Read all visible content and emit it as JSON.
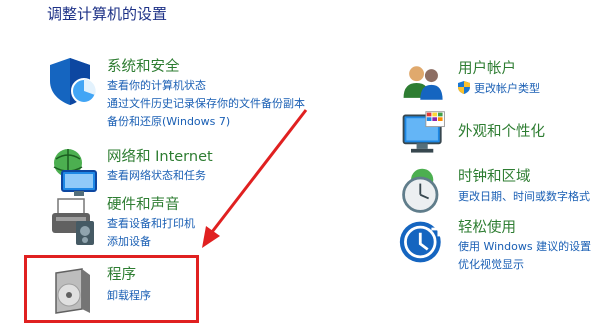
{
  "window": {
    "heading": "调整计算机的设置"
  },
  "left_categories": [
    {
      "title": "系统和安全",
      "icon": "shield-icon",
      "links": [
        "查看你的计算机状态",
        "通过文件历史记录保存你的文件备份副本",
        "备份和还原(Windows 7)"
      ]
    },
    {
      "title": "网络和 Internet",
      "icon": "network-icon",
      "links": [
        "查看网络状态和任务"
      ]
    },
    {
      "title": "硬件和声音",
      "icon": "printer-icon",
      "links": [
        "查看设备和打印机",
        "添加设备"
      ]
    },
    {
      "title": "程序",
      "icon": "programs-icon",
      "links": [
        "卸载程序"
      ]
    }
  ],
  "right_categories": [
    {
      "title": "用户帐户",
      "icon": "users-icon",
      "links": [
        "更改帐户类型"
      ]
    },
    {
      "title": "外观和个性化",
      "icon": "monitor-icon",
      "links": []
    },
    {
      "title": "时钟和区域",
      "icon": "clock-icon",
      "links": [
        "更改日期、时间或数字格式"
      ]
    },
    {
      "title": "轻松使用",
      "icon": "ease-of-access-icon",
      "links": [
        "使用 Windows 建议的设置",
        "优化视觉显示"
      ]
    }
  ],
  "annotation": {
    "color": "#e02020"
  },
  "colors": {
    "heading": "#1e3287",
    "title": "#2e7d32",
    "link": "#1a5fb4"
  }
}
